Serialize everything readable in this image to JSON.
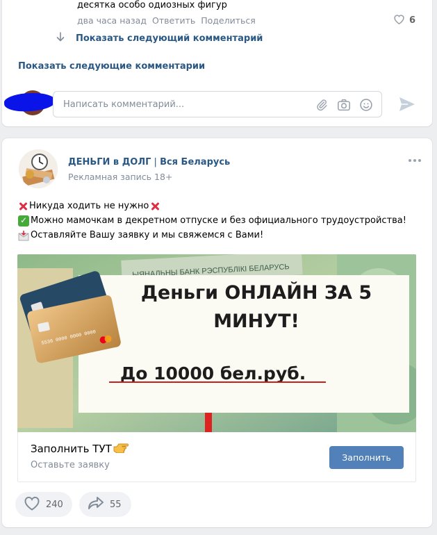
{
  "comment": {
    "text": "десятка особо одиозных фигур",
    "time": "два часа назад",
    "reply_label": "Ответить",
    "share_label": "Поделиться",
    "like_count": "6"
  },
  "thread": {
    "next_reply_label": "Показать следующий комментарий",
    "next_comments_label": "Показать следующие комментарии"
  },
  "comment_box": {
    "placeholder": "Написать комментарий..."
  },
  "ad": {
    "title_main": "ДЕНЬГИ в ДОЛГ",
    "title_sep": " | ",
    "title_rest": "Вся Беларусь",
    "subtitle": "Рекламная запись 18+",
    "lines": [
      "Никуда ходить не нужно",
      "Можно мамочкам в декретном отпуске и без официального трудоустройства!",
      "Оставляйте Вашу заявку и мы свяжемся с Вами!"
    ],
    "banner": {
      "headline_1": "Деньги ОНЛАЙН ЗА 5",
      "headline_2": "МИНУТ!",
      "amount": "До 10000 бел.руб.",
      "bill_text": "ЫЯНАЛЬНЫ БАНК РЭСПУБЛІКІ БЕЛАРУСЬ"
    },
    "cta": {
      "title": "Заполнить ТУТ",
      "subtitle": "Оставьте заявку",
      "button": "Заполнить"
    }
  },
  "reactions": {
    "likes": "240",
    "shares": "55"
  },
  "colors": {
    "link": "#2a5885",
    "muted": "#818c99",
    "button": "#5181b8",
    "background": "#edeef0"
  }
}
